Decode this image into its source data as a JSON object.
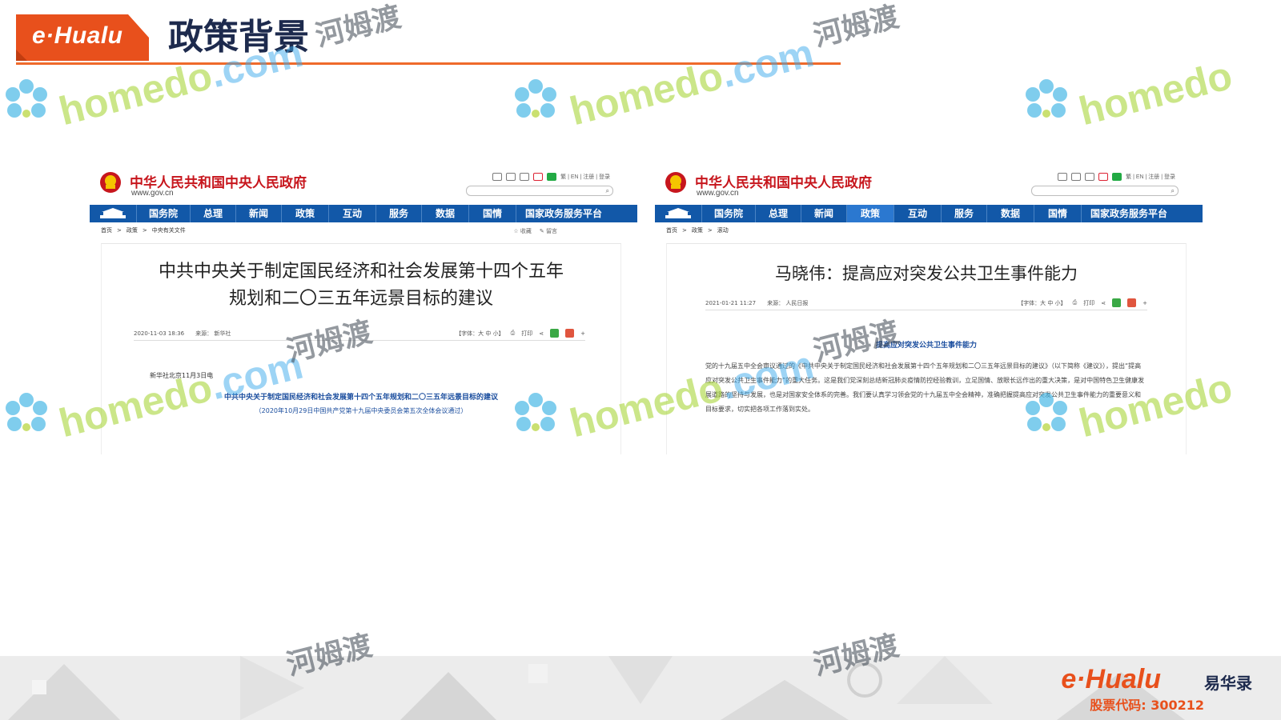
{
  "brand": {
    "logo_text": "e·Hualu",
    "accent_color": "#ef6a2b",
    "footer_logo": "e·Hualu",
    "footer_cn": "易华录",
    "stock_code": "股票代码: 300212"
  },
  "page": {
    "title": "政策背景"
  },
  "left_shot": {
    "gov_name": "中华人民共和国中央人民政府",
    "domain": "www.gov.cn",
    "util_text": "繁 | EN | 注册 | 登录",
    "nav": [
      "国务院",
      "总理",
      "新闻",
      "政策",
      "互动",
      "服务",
      "数据",
      "国情",
      "国家政务服务平台"
    ],
    "crumbs": [
      "首页",
      ">",
      "政策",
      ">",
      "中央有关文件"
    ],
    "crumb_actions": [
      "☆ 收藏",
      "✎ 留言"
    ],
    "title_line1": "中共中央关于制定国民经济和社会发展第十四个五年",
    "title_line2": "规划和二〇三五年远景目标的建议",
    "date": "2020-11-03 18:36",
    "source": "来源： 新华社",
    "font_ctrl": "【字体：大 中 小】",
    "print": "打印",
    "dateline": "新华社北京11月3日电",
    "doc_heading": "中共中央关于制定国民经济和社会发展第十四个五年规划和二〇三五年远景目标的建议",
    "doc_sub": "（2020年10月29日中国共产党第十九届中央委员会第五次全体会议通过）"
  },
  "right_shot": {
    "gov_name": "中华人民共和国中央人民政府",
    "domain": "www.gov.cn",
    "util_text": "繁 | EN | 注册 | 登录",
    "nav": [
      "国务院",
      "总理",
      "新闻",
      "政策",
      "互动",
      "服务",
      "数据",
      "国情",
      "国家政务服务平台"
    ],
    "active_nav": 3,
    "crumbs": [
      "首页",
      ">",
      "政策",
      ">",
      "滚动"
    ],
    "title": "马晓伟：提高应对突发公共卫生事件能力",
    "date": "2021-01-21 11:27",
    "source": "来源： 人民日报",
    "font_ctrl": "【字体：大 中 小】",
    "print": "打印",
    "heading": "提高应对突发公共卫生事件能力",
    "body": "党的十九届五中全会审议通过的《中共中央关于制定国民经济和社会发展第十四个五年规划和二〇三五年远景目标的建议》（以下简称《建议》），提出“提高应对突发公共卫生事件能力”的重大任务。这是我们党深刻总结新冠肺炎疫情防控经验教训，立足国情、放眼长远作出的重大决策，是对中国特色卫生健康发展道路的坚持与发展，也是对国家安全体系的完善。我们要认真学习领会党的十九届五中全会精神，准确把握提高应对突发公共卫生事件能力的重要意义和目标要求，切实把各项工作落到实处。"
  },
  "watermark": {
    "en_main": "homedo",
    "en_dom": ".com",
    "cn": "河姆渡"
  }
}
